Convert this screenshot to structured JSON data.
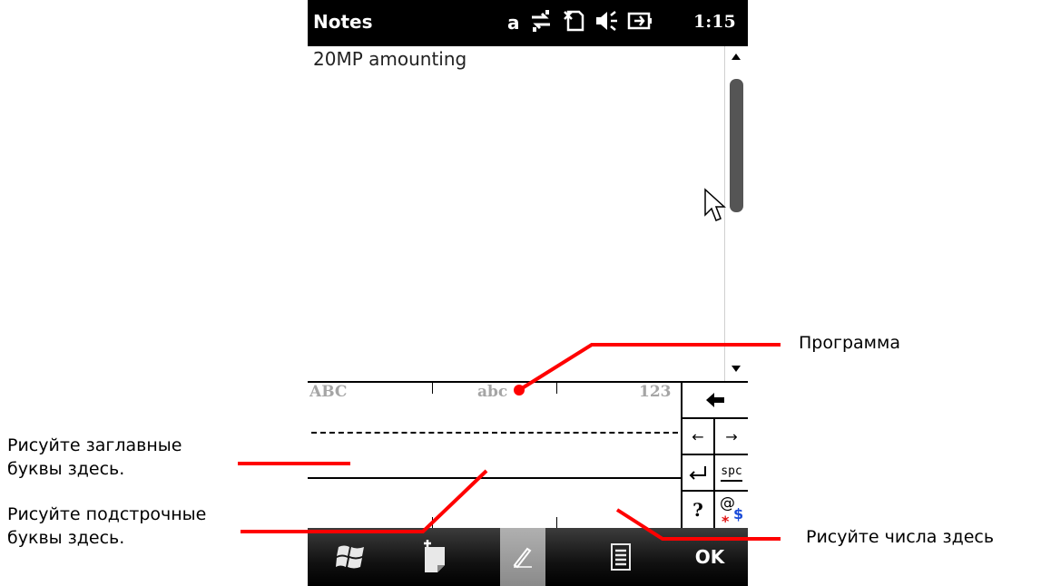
{
  "statusbar": {
    "app_title": "Notes",
    "input_indicator": "a",
    "time": "1:15"
  },
  "note": {
    "text": "20MP amounting"
  },
  "letter_recognizer": {
    "upper_zone_label": "ABC",
    "lower_zone_label": "abc",
    "number_zone_label": "123",
    "keys": {
      "backspace": "🡄",
      "left_arrow": "←",
      "right_arrow": "→",
      "enter": "↵",
      "space": "spc",
      "question": "?",
      "symbols_at": "@",
      "symbols_dollar": "$",
      "symbols_star": "*"
    }
  },
  "taskbar": {
    "ok_label": "OK"
  },
  "callouts": {
    "program": "Программа",
    "uppercase_line1": "Рисуйте заглавные",
    "uppercase_line2": "буквы здесь.",
    "lowercase_line1": "Рисуйте подстрочные",
    "lowercase_line2": " буквы здесь.",
    "numbers": "Рисуйте числа здесь"
  },
  "colors": {
    "callout_line": "#ff0000",
    "statusbar_bg": "#000000",
    "zone_label": "#a5a5a5"
  },
  "icons": [
    "connectivity-icon",
    "no-sim-icon",
    "speaker-icon",
    "battery-charging-icon",
    "windows-start-icon",
    "new-note-icon",
    "pen-icon",
    "menu-icon",
    "mouse-cursor-icon"
  ]
}
